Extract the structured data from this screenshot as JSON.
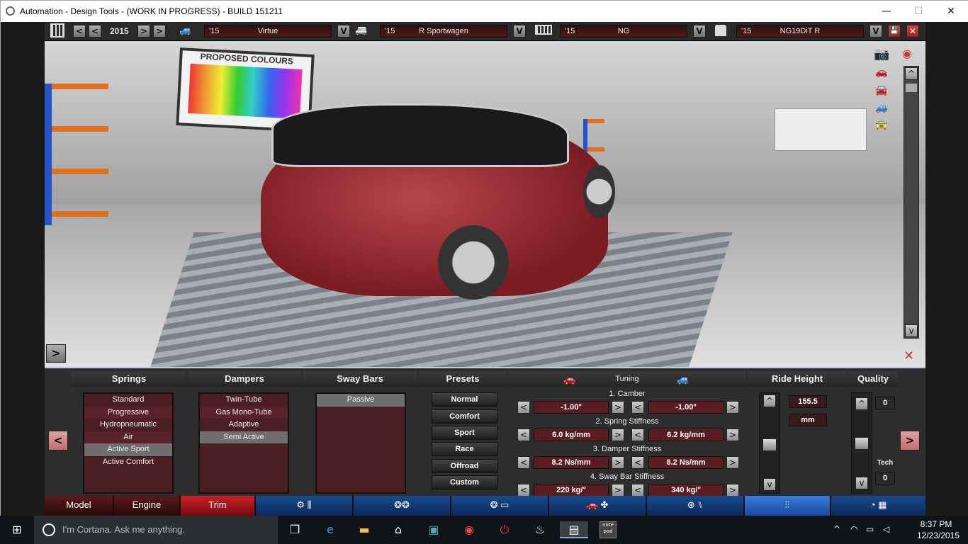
{
  "window": {
    "title": "Automation - Design Tools - (WORK IN PROGRESS) - BUILD 151211",
    "min": "—",
    "max": "☐",
    "close": "✕"
  },
  "topbar": {
    "year": "2015",
    "model": {
      "year": "'15",
      "name": "Virtue"
    },
    "trim": {
      "year": "'15",
      "name": "R Sportwagen"
    },
    "engine_family": {
      "year": "'15",
      "name": "NG"
    },
    "engine": {
      "year": "'15",
      "name": "NG19DiT R"
    },
    "prev": "<",
    "next": ">",
    "dropdown": "V",
    "save": "💾",
    "close": "✕"
  },
  "scene": {
    "poster": "PROPOSED COLOURS"
  },
  "panel": {
    "headers": {
      "springs": "Springs",
      "dampers": "Dampers",
      "sway": "Sway Bars",
      "presets": "Presets",
      "tuning": "Tuning",
      "ride": "Ride Height",
      "quality": "Quality"
    },
    "springs": [
      "Standard",
      "Progressive",
      "Hydropneumatic",
      "Air",
      "Active Sport",
      "Active Comfort"
    ],
    "springs_selected": "Active Sport",
    "dampers": [
      "Twin-Tube",
      "Gas Mono-Tube",
      "Adaptive",
      "Semi Active"
    ],
    "dampers_selected": "Semi Active",
    "sway": [
      "Passive"
    ],
    "sway_selected": "Passive",
    "presets": [
      "Normal",
      "Comfort",
      "Sport",
      "Race",
      "Offroad",
      "Custom"
    ],
    "tuning": [
      {
        "label": "1. Camber",
        "front": "-1.00°",
        "rear": "-1.00°"
      },
      {
        "label": "2. Spring Stiffness",
        "front": "6.0 kg/mm",
        "rear": "6.2 kg/mm"
      },
      {
        "label": "3. Damper Stiffness",
        "front": "8.2 Ns/mm",
        "rear": "8.2 Ns/mm"
      },
      {
        "label": "4. Sway Bar Stiffness",
        "front": "220 kg/°",
        "rear": "340 kg/°"
      }
    ],
    "ride_height": "155.5",
    "ride_unit": "mm",
    "quality": "0",
    "tech_label": "Tech",
    "tech": "0",
    "less": "<",
    "more": ">",
    "up": "^",
    "down": "v"
  },
  "bottomnav": {
    "model": "Model",
    "engine": "Engine",
    "trim": "Trim"
  },
  "taskbar": {
    "cortana": "I'm Cortana. Ask me anything.",
    "time": "8:37 PM",
    "date": "12/23/2015",
    "notepad": "note pad"
  }
}
